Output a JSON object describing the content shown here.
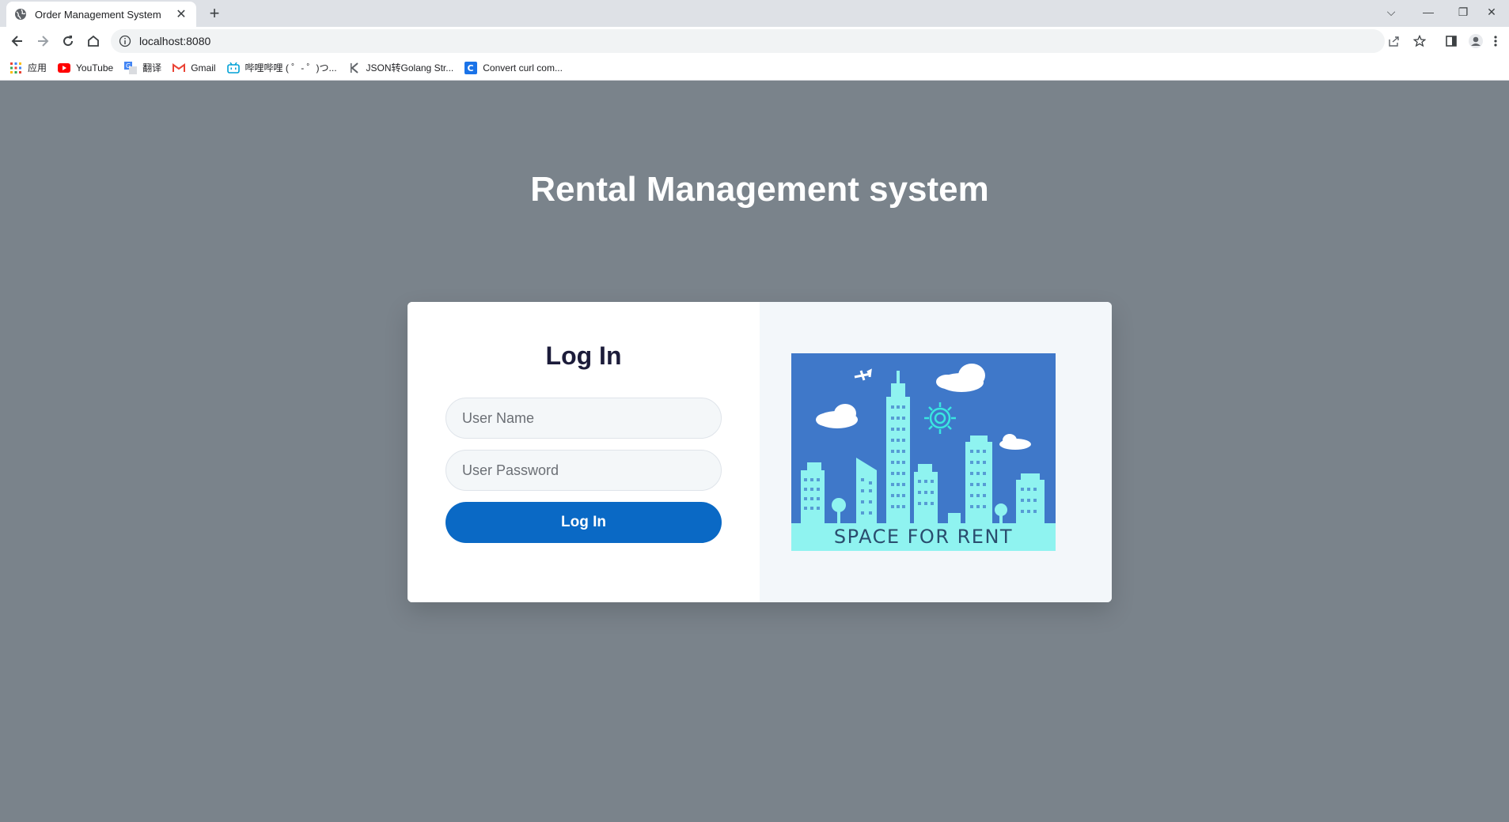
{
  "browser": {
    "tab_title": "Order Management System",
    "tab_close": "✕",
    "new_tab": "+",
    "url": "localhost:8080",
    "window_controls": {
      "tabsearch": "⌵",
      "minimize": "—",
      "restore": "❐",
      "close": "✕"
    },
    "bookmarks": [
      {
        "label": "应用",
        "icon": "apps-grid-icon"
      },
      {
        "label": "YouTube",
        "icon": "youtube-icon"
      },
      {
        "label": "翻译",
        "icon": "translate-icon"
      },
      {
        "label": "Gmail",
        "icon": "gmail-icon"
      },
      {
        "label": "哔哩哔哩 ( ゜- ゜)つ...",
        "icon": "bilibili-icon"
      },
      {
        "label": "JSON转Golang Str...",
        "icon": "json-icon"
      },
      {
        "label": "Convert curl com...",
        "icon": "curl-icon"
      }
    ]
  },
  "page": {
    "heading": "Rental Management system",
    "login": {
      "title": "Log In",
      "username_placeholder": "User Name",
      "password_placeholder": "User Password",
      "submit_label": "Log In"
    },
    "poster_text": "SPACE FOR RENT"
  },
  "colors": {
    "page_bg": "#7a838b",
    "button": "#0a69c5",
    "poster_sky": "#3f78c9",
    "poster_ground": "#8ff3f0"
  }
}
